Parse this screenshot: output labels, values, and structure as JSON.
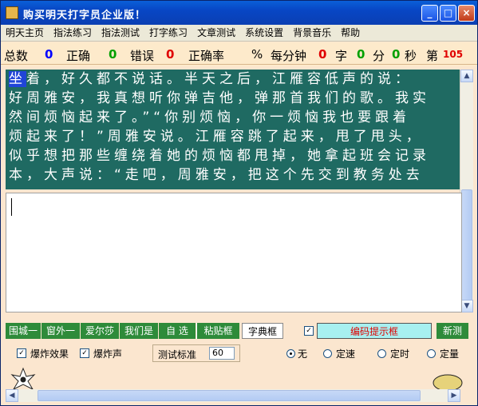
{
  "window": {
    "title": "购买明天打字员企业版！",
    "controls": {
      "minimize": "_",
      "maximize": "□",
      "close": "×"
    }
  },
  "menu": [
    "明天主页",
    "指法练习",
    "指法测试",
    "打字练习",
    "文章测试",
    "系统设置",
    "背景音乐",
    "帮助"
  ],
  "stats": {
    "total_label": "总数",
    "total_value": "0",
    "correct_label": "正确",
    "correct_value": "0",
    "error_label": "错误",
    "error_value": "0",
    "rate_label": "正确率",
    "rate_value": "%",
    "speed_label": "每分钟",
    "speed_value": "0",
    "speed_unit": "字",
    "min_value": "0",
    "min_unit": "分",
    "sec_value": "0",
    "sec_unit": "秒",
    "index_label": "第",
    "index_value": "105"
  },
  "passage": {
    "current_char": "坐",
    "lines": [
      "着，好久都不说话。半天之后，江雁容低声的说：",
      "好周雅安，我真想听你弹吉他，弹那首我们的歌。我实",
      "然间烦恼起来了。”“你别烦恼，你一烦恼我也要跟着",
      "烦起来了！”周雅安说。江雁容跳了起来，甩了甩头，",
      "似乎想把那些缠绕着她的烦恼都甩掉，她拿起班会记录",
      "本，大声说：“走吧，周雅安，把这个先交到教务处去"
    ]
  },
  "input": {
    "value": ""
  },
  "toolbar": {
    "items": [
      "围城一",
      "窗外一",
      "爱尔莎",
      "我们是",
      "自 选"
    ],
    "paste_label": "粘贴框",
    "dict_label": "字典框",
    "dict_checked": "✓",
    "hint_label": "编码提示框",
    "new_test_label": "新测"
  },
  "options": {
    "explosion_effect": {
      "label": "爆炸效果",
      "checked": "✓"
    },
    "explosion_sound": {
      "label": "爆炸声",
      "checked": "✓"
    },
    "test_standard_label": "测试标准",
    "test_standard_value": "60",
    "radios": [
      {
        "label": "无",
        "selected": true
      },
      {
        "label": "定速",
        "selected": false
      },
      {
        "label": "定时",
        "selected": false
      },
      {
        "label": "定量",
        "selected": false
      }
    ]
  },
  "colors": {
    "passage_bg": "#1f6a62",
    "stat_blue": "#0000ff",
    "stat_green": "#00a000",
    "stat_red": "#e00000",
    "toolbar_green": "#2e8b3a",
    "hint_bg": "#a7f0f0",
    "hint_text": "#e00000"
  }
}
